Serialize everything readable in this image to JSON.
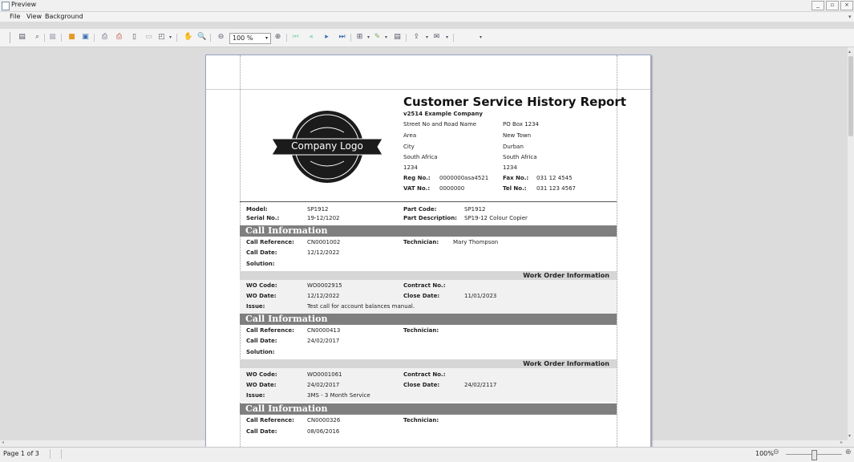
{
  "window": {
    "title": "Preview",
    "controls": [
      "_",
      "▫",
      "×"
    ]
  },
  "menu": {
    "file": "File",
    "view": "View",
    "background": "Background"
  },
  "toolbar": {
    "zoom_value": "100 %"
  },
  "report": {
    "title": "Customer Service History Report",
    "company_name": "v2514 Example Company",
    "logo_text": "Company Logo",
    "address_left": [
      "Street No and Road Name",
      "Area",
      "City",
      "South Africa",
      "1234"
    ],
    "address_right": [
      "PO Box 1234",
      "New Town",
      "Durban",
      "South Africa",
      "1234"
    ],
    "reg_label": "Reg No.:",
    "reg_value": "0000000asa4521",
    "vat_label": "VAT No.:",
    "vat_value": "0000000",
    "fax_label": "Fax No.:",
    "fax_value": "031 12 4545",
    "tel_label": "Tel No.:",
    "tel_value": "031 123 4567",
    "model_label": "Model:",
    "model_value": "SP1912",
    "serial_label": "Serial No.:",
    "serial_value": "19-12/1202",
    "partcode_label": "Part Code:",
    "partcode_value": "SP1912",
    "partdesc_label": "Part Description:",
    "partdesc_value": "SP19-12 Colour Copier",
    "labels": {
      "call_info": "Call Information",
      "call_ref": "Call Reference:",
      "call_date": "Call Date:",
      "solution": "Solution:",
      "technician": "Technician:",
      "wo_info": "Work Order Information",
      "wo_code": "WO Code:",
      "wo_date": "WO Date:",
      "issue": "Issue:",
      "contract": "Contract No.:",
      "close_date": "Close Date:"
    },
    "calls": [
      {
        "ref": "CN0001002",
        "date": "12/12/2022",
        "technician": "Mary Thompson",
        "wo_code": "WO0002915",
        "wo_date": "12/12/2022",
        "close_date": "11/01/2023",
        "issue": "Test call for account balances manual."
      },
      {
        "ref": "CN0000413",
        "date": "24/02/2017",
        "technician": "",
        "wo_code": "WO0001061",
        "wo_date": "24/02/2017",
        "close_date": "24/02/2117",
        "issue": "3MS - 3 Month Service"
      },
      {
        "ref": "CN0000326",
        "date": "08/06/2016",
        "technician": ""
      }
    ]
  },
  "status": {
    "page": "Page 1 of 3",
    "zoom": "100%"
  }
}
